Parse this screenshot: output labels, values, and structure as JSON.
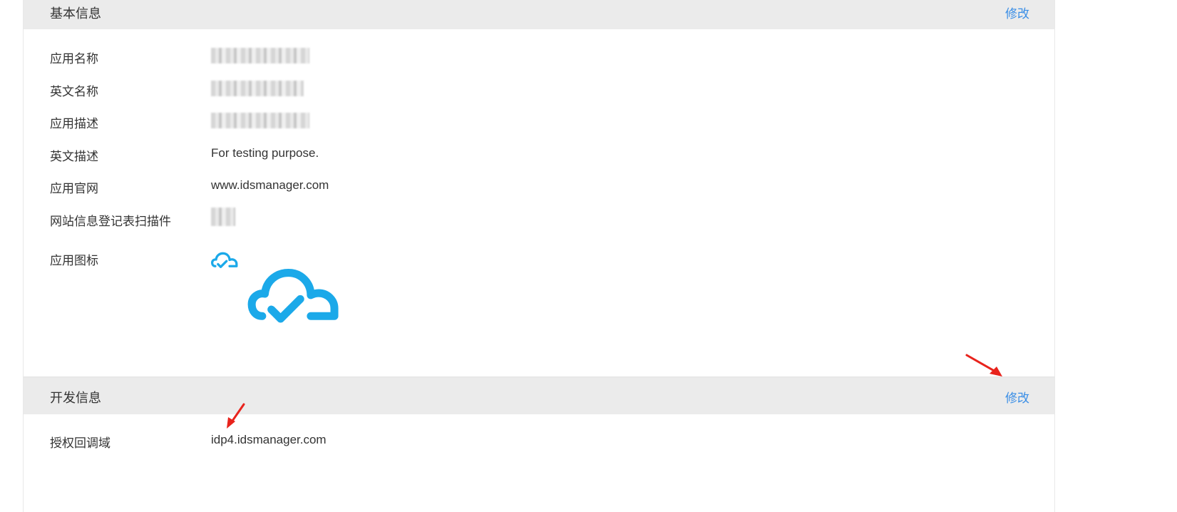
{
  "sections": {
    "basic": {
      "title": "基本信息",
      "edit_label": "修改",
      "rows": [
        {
          "label": "应用名称",
          "value": ""
        },
        {
          "label": "英文名称",
          "value": ""
        },
        {
          "label": "应用描述",
          "value": ""
        },
        {
          "label": "英文描述",
          "value": "For testing purpose."
        },
        {
          "label": "应用官网",
          "value": "www.idsmanager.com"
        },
        {
          "label": "网站信息登记表扫描件",
          "value": ""
        },
        {
          "label": "应用图标",
          "value": ""
        }
      ]
    },
    "dev": {
      "title": "开发信息",
      "edit_label": "修改",
      "rows": [
        {
          "label": "授权回调域",
          "value": "idp4.idsmanager.com"
        }
      ]
    }
  },
  "colors": {
    "link": "#3a8ee6",
    "header_bg": "#ebebeb",
    "logo": "#1ba9e9",
    "annotation_arrow": "#e8231c"
  },
  "icons": [
    "app-cloud-logo-icon",
    "annotation-arrow-icon"
  ]
}
